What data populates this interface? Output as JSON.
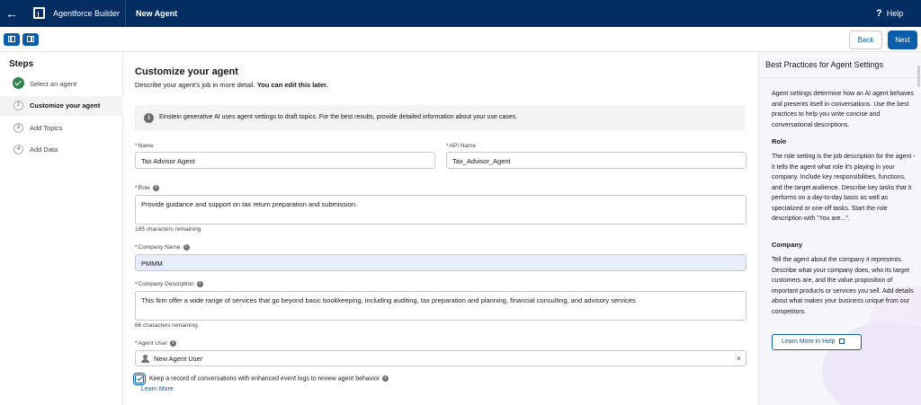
{
  "topbar": {
    "app_name": "Agentforce Builder",
    "page_title": "New Agent",
    "help_label": "Help"
  },
  "toolbar": {
    "back_label": "Back",
    "next_label": "Next"
  },
  "steps": {
    "title": "Steps",
    "items": [
      {
        "num": "1",
        "label": "Select an agent",
        "state": "complete"
      },
      {
        "num": "2",
        "label": "Customize your agent",
        "state": "active"
      },
      {
        "num": "3",
        "label": "Add Topics",
        "state": "pending"
      },
      {
        "num": "4",
        "label": "Add Data",
        "state": "pending"
      }
    ]
  },
  "main": {
    "heading": "Customize your agent",
    "description": "Describe your agent's job in more detail.",
    "description_bold": "You can edit this later.",
    "notice": "Einstein generative AI uses agent settings to draft topics. For the best results, provide detailed information about your use cases.",
    "name_label": "Name",
    "name_value": "Tax Advisor Agent",
    "api_label": "API Name",
    "api_value": "Tax_Advisor_Agent",
    "role_label": "Role",
    "role_value": "Provide guidance and support on tax return preparation and submission.",
    "role_hint": "185 characters remaining",
    "company_label": "Company Name",
    "company_value": "PMMM",
    "company_desc_label": "Company Description",
    "company_desc_value": "This firm offer a wide range of services that go beyond basic bookkeeping, including auditing, tax preparation and planning, financial consulting, and advisory services",
    "company_desc_hint": "86 characters remaining",
    "agent_user_label": "Agent User",
    "agent_user_value": "New Agent User",
    "checkbox_label": "Keep a record of conversations with enhanced event logs to review agent behavior",
    "learn_more": "Learn More"
  },
  "panel": {
    "title": "Best Practices for Agent Settings",
    "intro": "Agent settings determine how an AI agent behaves and presents itself in conversations. Use the best practices to help you write concise and conversational descriptions.",
    "role_heading": "Role",
    "role_text": "The role setting is the job description for the agent - it tells the agent what role it's playing in your company. Include key responsibilities, functions, and the target audience. Describe key tasks that it performs on a day-to-day basis as well as specialized or one-off tasks. Start the role description with \"You are...\".",
    "company_heading": "Company",
    "company_text": "Tell the agent about the company it represents. Describe what your company does, who its target customers are, and the value proposition of important products or services you sell. Add details about what makes your business unique from our competitors.",
    "learn_button": "Learn More in Help"
  }
}
